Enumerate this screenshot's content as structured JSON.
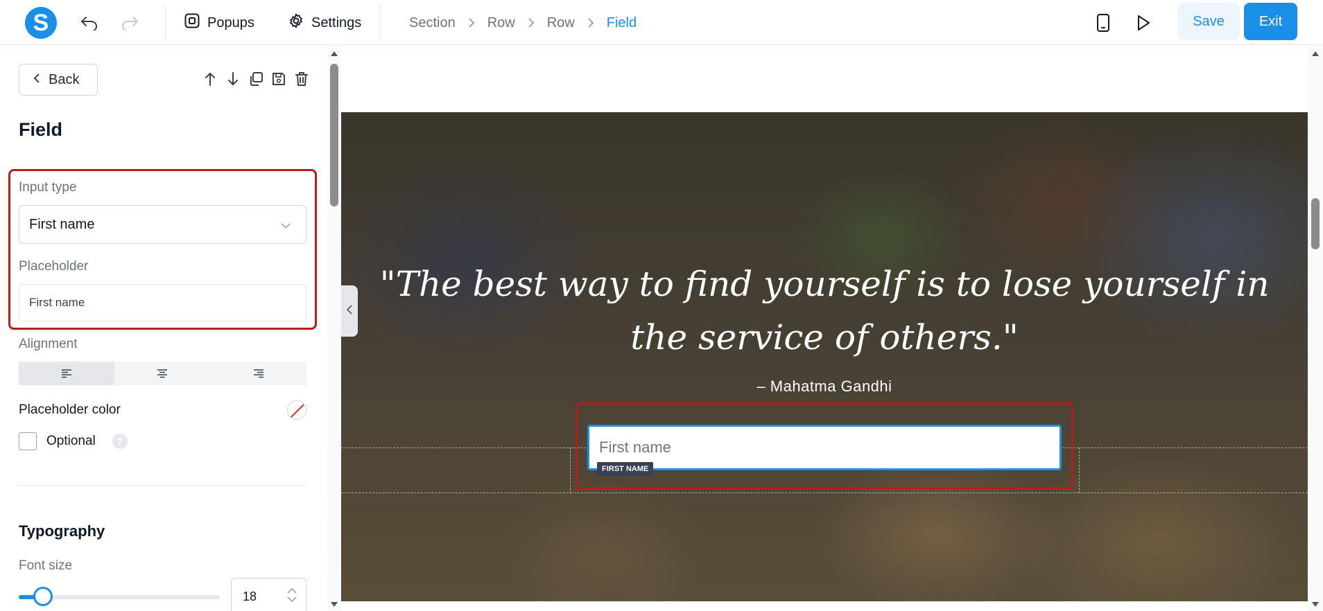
{
  "app": {
    "logo_letter": "S",
    "brand_color": "#1a8fe8"
  },
  "toolbar": {
    "undo_icon": "undo-icon",
    "redo_icon": "redo-icon",
    "popups_label": "Popups",
    "settings_label": "Settings",
    "save_label": "Save",
    "exit_label": "Exit"
  },
  "breadcrumb": {
    "items": [
      "Section",
      "Row",
      "Row",
      "Field"
    ],
    "active_index": 3
  },
  "panel": {
    "back_label": "Back",
    "title": "Field",
    "input_type": {
      "label": "Input type",
      "value": "First name"
    },
    "placeholder": {
      "label": "Placeholder",
      "value": "First name"
    },
    "alignment": {
      "label": "Alignment",
      "options": [
        "align-left-icon",
        "align-center-icon",
        "align-right-icon"
      ],
      "selected": "left"
    },
    "placeholder_color": {
      "label": "Placeholder color",
      "value": "none"
    },
    "optional": {
      "label": "Optional",
      "checked": false,
      "help": "?"
    },
    "typography": {
      "title": "Typography",
      "font_size_label": "Font size",
      "font_size_value": "18",
      "font_size_fraction": 0.12
    }
  },
  "canvas": {
    "quote": "\"The best way to find yourself is to lose yourself in the service of others.\"",
    "author": "– Mahatma Gandhi",
    "field_placeholder": "First name",
    "field_tag": "FIRST NAME"
  },
  "colors": {
    "highlight": "#b91c1c",
    "selected_field_border": "#1a8fe8"
  }
}
